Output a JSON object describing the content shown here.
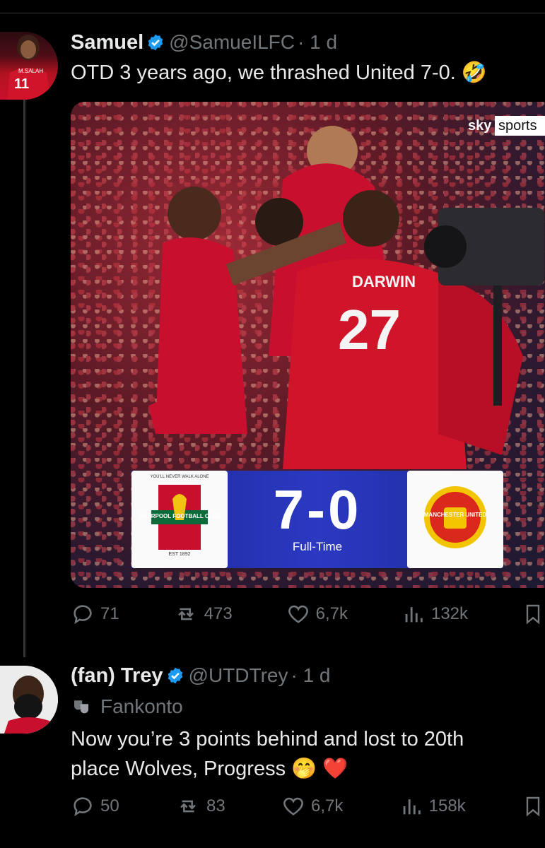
{
  "tweet1": {
    "name": "Samuel",
    "handle": "@SamueILFC",
    "time": "· 1 d",
    "text": "OTD 3 years ago, we thrashed United 7-0. 🤣",
    "avatar_label": "M.SALAH",
    "avatar_number": "11",
    "media": {
      "broadcaster_1": "sky",
      "broadcaster_2": "sports",
      "player_name": "DARWIN",
      "player_number": "27",
      "score": "7-0",
      "status": "Full-Time",
      "home_team": "LIVERPOOL FOOTBALL CLUB",
      "home_motto": "YOU'LL NEVER WALK ALONE",
      "home_est": "EST 1892",
      "away_team": "MANCHESTER UNITED"
    },
    "stats": {
      "replies": "71",
      "reposts": "473",
      "likes": "6,7k",
      "views": "132k"
    }
  },
  "tweet2": {
    "name": "(fan) Trey",
    "handle": "@UTDTrey",
    "time": "· 1 d",
    "label": "Fankonto",
    "text_line1": "Now you’re 3 points behind and lost to 20th",
    "text_line2": "place Wolves, Progress 🤭 ❤️",
    "stats": {
      "replies": "50",
      "reposts": "83",
      "likes": "6,7k",
      "views": "158k"
    }
  },
  "colors": {
    "verified": "#1d9bf0",
    "muted": "#71767b",
    "text": "#e7e9ea",
    "liverpool_red": "#c8102e",
    "score_blue": "#2b39c2"
  }
}
